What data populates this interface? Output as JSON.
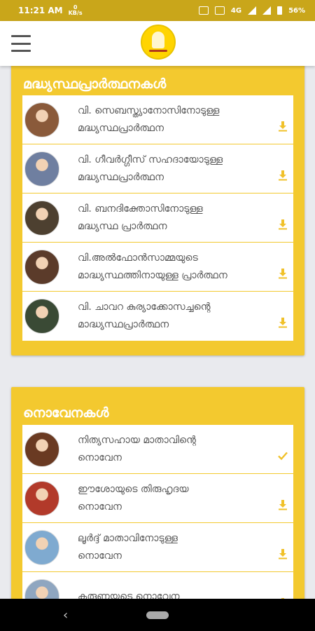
{
  "status_bar": {
    "time": "11:21 AM",
    "speed_value": "0",
    "speed_unit": "KB/s",
    "network": "4G",
    "battery": "56%"
  },
  "app_bar": {
    "menu_icon": "hamburger-menu-icon",
    "logo_icon": "praying-hands-logo"
  },
  "sections": [
    {
      "title": "മദ്ധ്യസ്ഥപ്രാർത്ഥനകൾ",
      "items": [
        {
          "label": "വി. സെബസ്ത്യാനോസിനോടുള്ള\nമദ്ധ്യസ്ഥപ്രാർത്ഥന",
          "action": "download",
          "avatar_color": "#8a5a3a"
        },
        {
          "label": "വി. ഗീവർഗ്ഗീസ് സഹദായോടുള്ള\nമദ്ധ്യസ്ഥപ്രാർത്ഥന",
          "action": "download",
          "avatar_color": "#6f7fa0"
        },
        {
          "label": "വി. ബനദിക്തോസിനോടുള്ള\nമദ്ധ്യസ്ഥ പ്രാർത്ഥന",
          "action": "download",
          "avatar_color": "#4d4030"
        },
        {
          "label": "വി.അൽഫോൻസാമ്മയുടെ\nമാദ്ധ്യസ്ഥത്തിനായുള്ള പ്രാർത്ഥന",
          "action": "download",
          "avatar_color": "#5b3b2a"
        },
        {
          "label": "വി. ചാവറ കുര്യാക്കോസച്ചന്റെ\nമാദ്ധ്യസ്ഥപ്രാർത്ഥന",
          "action": "download",
          "avatar_color": "#3a4a35"
        }
      ]
    },
    {
      "title": "നൊവേനകൾ",
      "items": [
        {
          "label": "നിത്യസഹായ മാതാവിന്റെ\nനൊവേന",
          "action": "downloaded",
          "avatar_color": "#6a3a22"
        },
        {
          "label": "ഈശോയുടെ തിരുഹൃദയ\nനൊവേന",
          "action": "download",
          "avatar_color": "#b23a2a"
        },
        {
          "label": "ലൂർദ്ദ് മാതാവിനോടുള്ള\nനൊവേന",
          "action": "download",
          "avatar_color": "#7faad0"
        },
        {
          "label": "കരുണയുടെ നൊവേന",
          "action": "download",
          "avatar_color": "#8fa6c0"
        }
      ]
    }
  ],
  "icons": {
    "download": "download-icon",
    "downloaded": "check-icon"
  },
  "colors": {
    "accent": "#f3c92f",
    "status_bar": "#c9a61a",
    "icon": "#f0c12a"
  },
  "nav_bar": {
    "back": "‹"
  }
}
